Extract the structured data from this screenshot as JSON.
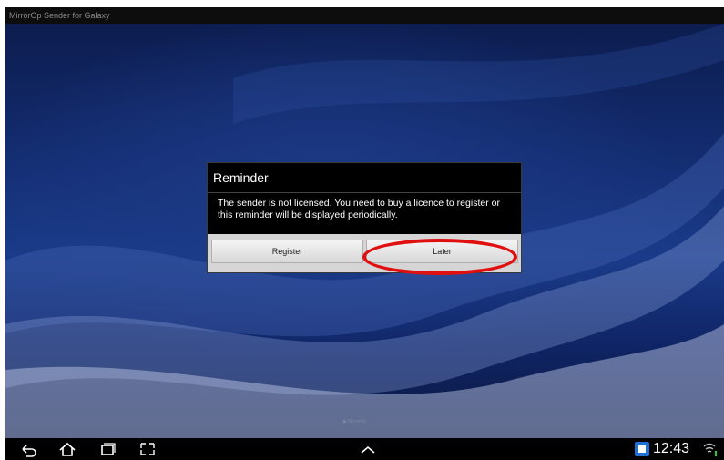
{
  "window": {
    "title": "MirrorOp Sender for Galaxy"
  },
  "dialog": {
    "title": "Reminder",
    "message_line1": "The sender is not licensed. You need to buy a licence to register or",
    "message_line2": "this reminder will be displayed periodically.",
    "register_label": "Register",
    "later_label": "Later"
  },
  "watermark": {
    "text": "MirrorOp"
  },
  "status_bar": {
    "time": "12:43",
    "icons": [
      "back-icon",
      "home-icon",
      "recent-apps-icon",
      "screenshot-icon",
      "chevron-up-icon",
      "app-notification-icon",
      "wifi-icon"
    ]
  },
  "colors": {
    "highlight": "#e01010",
    "background": "#142e73",
    "dialog": "#000000"
  }
}
